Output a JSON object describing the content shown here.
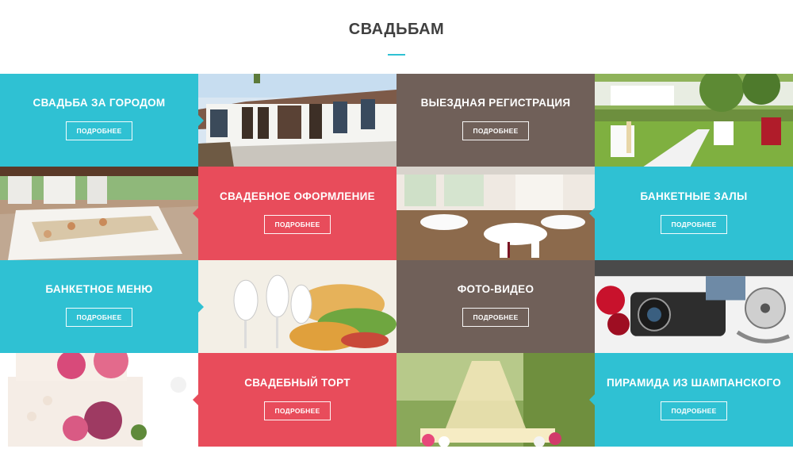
{
  "page": {
    "title": "СВАДЬБАМ",
    "accent": "#2fc1d3"
  },
  "colors": {
    "teal": "#2fc1d3",
    "brown": "#706059",
    "red": "#e84c5b"
  },
  "tiles": [
    {
      "title": "СВАДЬБА ЗА ГОРОДОМ",
      "button": "ПОДРОБНЕЕ",
      "color": "teal"
    },
    {
      "title": "ВЫЕЗДНАЯ РЕГИСТРАЦИЯ",
      "button": "ПОДРОБНЕЕ",
      "color": "brown"
    },
    {
      "title": "СВАДЕБНОЕ ОФОРМЛЕНИЕ",
      "button": "ПОДРОБНЕЕ",
      "color": "red"
    },
    {
      "title": "БАНКЕТНЫЕ ЗАЛЫ",
      "button": "ПОДРОБНЕЕ",
      "color": "teal"
    },
    {
      "title": "БАНКЕТНОЕ МЕНЮ",
      "button": "ПОДРОБНЕЕ",
      "color": "teal"
    },
    {
      "title": "ФОТО-ВИДЕО",
      "button": "ПОДРОБНЕЕ",
      "color": "brown"
    },
    {
      "title": "СВАДЕБНЫЙ ТОРТ",
      "button": "ПОДРОБНЕЕ",
      "color": "red"
    },
    {
      "title": "ПИРАМИДА ИЗ ШАМПАНСКОГО",
      "button": "ПОДРОБНЕЕ",
      "color": "teal"
    }
  ]
}
